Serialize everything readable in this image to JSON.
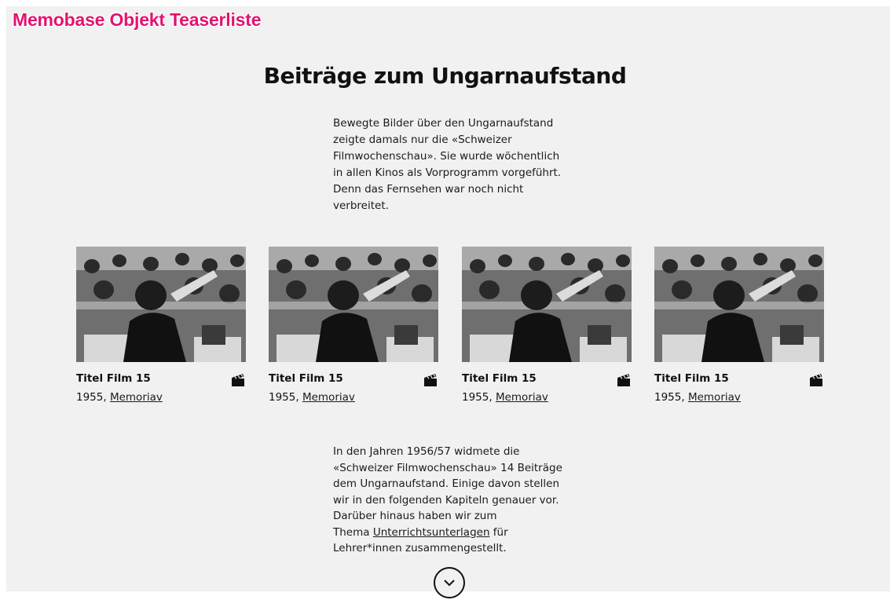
{
  "label": {
    "text": "Memobase Objekt Teaserliste",
    "color": "#e2136e"
  },
  "header": {
    "title": "Beiträge zum Ungarnaufstand"
  },
  "intro": {
    "lines": [
      "Bewegte Bilder über den Ungarnaufstand",
      "zeigte damals nur die «Schweizer",
      "Filmwochenschau». Sie  wurde wöchentlich",
      "in allen Kinos als Vorprogramm vorgeführt.",
      "Denn das Fernsehen war noch nicht",
      "verbreitet."
    ]
  },
  "cards": [
    {
      "title": "Titel Film 15",
      "year": "1955, ",
      "source": "Memoriav",
      "icon": "film-clapper-icon"
    },
    {
      "title": "Titel Film 15",
      "year": "1955, ",
      "source": "Memoriav",
      "icon": "film-clapper-icon"
    },
    {
      "title": "Titel Film 15",
      "year": "1955, ",
      "source": "Memoriav",
      "icon": "film-clapper-icon"
    },
    {
      "title": "Titel Film 15",
      "year": "1955, ",
      "source": "Memoriav",
      "icon": "film-clapper-icon"
    }
  ],
  "body": {
    "line1": "In den Jahren 1956/57 widmete die",
    "line2": "«Schweizer Filmwochenschau» 14 Beiträge",
    "line3": "dem Ungarnaufstand. Einige davon stellen",
    "line4": "wir in den folgenden Kapiteln genauer vor.",
    "line5": "Darüber hinaus haben wir zum",
    "line6_prefix": "Thema ",
    "line6_link": "Unterrichtsunterlagen",
    "line6_suffix": " für",
    "line7": "Lehrer*innen zusammengestellt."
  },
  "scroll": {
    "icon": "chevron-down-icon"
  }
}
